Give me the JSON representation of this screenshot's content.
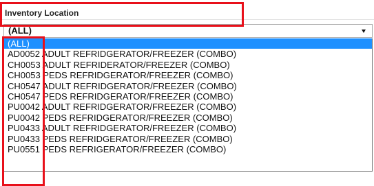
{
  "field": {
    "label": "Inventory Location"
  },
  "select": {
    "value": "(ALL)",
    "arrow_icon": "triangle-down-icon"
  },
  "options": [
    "(ALL)",
    "AD0052 ADULT REFRIDGERATOR/FREEZER (COMBO)",
    "CH0053 ADULT REFRIDERATOR/FREEZER (COMBO)",
    "CH0053 PEDS REFRIDGERATOR/FREEZER (COMBO)",
    "CH0547 ADULT REFRIDGERATOR/FREEZER (COMBO)",
    "CH0547 PEDS REFRIDGERATOR/FREEZER (COMBO)",
    "PU0042 ADULT REFRIDGERATOR/FREEZER (COMBO)",
    "PU0042 PEDS REFRIDGERATOR/FREEZER (COMBO)",
    "PU0433 ADULT REFRIDGERATOR/FREEZER (COMBO)",
    "PU0433 PEDS REFRIDGERATOR/FREEZER (COMBO)",
    "PU0551 PEDS REFRIGERATOR/FREEZER (COMBO)"
  ],
  "colors": {
    "highlight_border": "#e8101a",
    "selected_background": "#1e90ff",
    "selected_text": "#ffffff"
  }
}
